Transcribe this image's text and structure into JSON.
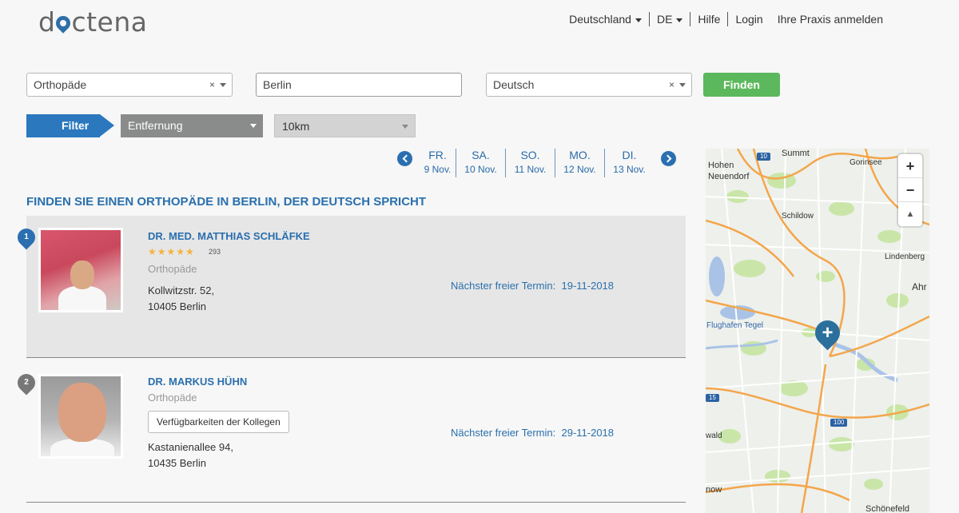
{
  "header": {
    "logo": {
      "prefix": "d",
      "suffix": "ctena"
    },
    "nav": {
      "country": "Deutschland",
      "lang": "DE",
      "help": "Hilfe",
      "login": "Login",
      "register": "Ihre Praxis anmelden"
    }
  },
  "search": {
    "specialty": "Orthopäde",
    "city": "Berlin",
    "language": "Deutsch",
    "clear_glyph": "×",
    "find_label": "Finden"
  },
  "filter": {
    "label": "Filter",
    "sort": "Entfernung",
    "radius": "10km"
  },
  "dates": [
    {
      "day": "FR.",
      "date": "9 Nov."
    },
    {
      "day": "SA.",
      "date": "10 Nov."
    },
    {
      "day": "SO.",
      "date": "11 Nov."
    },
    {
      "day": "MO.",
      "date": "12 Nov."
    },
    {
      "day": "DI.",
      "date": "13 Nov."
    }
  ],
  "page_title": "FINDEN SIE EINEN ORTHOPÄDE IN BERLIN, DER DEUTSCH SPRICHT",
  "results": [
    {
      "rank": "1",
      "name": "DR. MED. MATTHIAS SCHLÄFKE",
      "stars": "★★★★★",
      "reviews": "293",
      "specialty": "Orthopäde",
      "street": "Kollwitzstr. 52,",
      "city": "10405 Berlin",
      "next_label": "Nächster freier Termin:",
      "next_date": "19-11-2018"
    },
    {
      "rank": "2",
      "name": "DR. MARKUS HÜHN",
      "specialty": "Orthopäde",
      "colleagues_button": "Verfügbarkeiten der Kollegen",
      "street": "Kastanienallee 94,",
      "city": "10435 Berlin",
      "next_label": "Nächster freier Termin:",
      "next_date": "29-11-2018"
    }
  ],
  "map": {
    "zoom_in": "+",
    "zoom_out": "−",
    "reset": "▲",
    "pin_glyph": "+",
    "labels": {
      "hohen_1": "Hohen",
      "hohen_2": "Neuendorf",
      "summt": "Summt",
      "gorinsee": "Gorinsee",
      "schildow": "Schildow",
      "lindenberg": "Lindenberg",
      "ahr": "Ahr",
      "tegel": "Flughafen Tegel",
      "wald": "wald",
      "now": "now",
      "schoeneweide": "Schönefeld"
    },
    "roads": {
      "r10": "10",
      "r15": "15",
      "r100": "100"
    },
    "colors": {
      "road_orange": "#f3a64b",
      "road_white": "#ffffff",
      "park": "#c9e6a8",
      "water": "#a9c3e6"
    }
  }
}
